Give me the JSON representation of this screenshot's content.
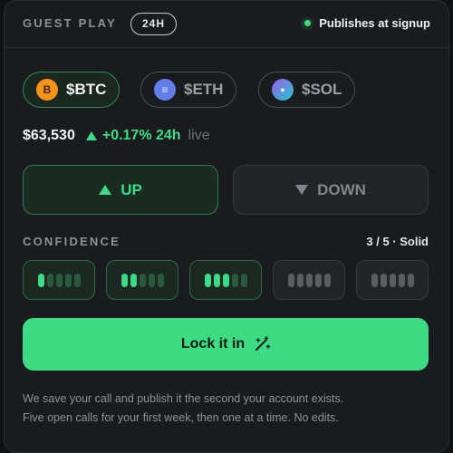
{
  "header": {
    "title": "GUEST PLAY",
    "period_pill": "24H",
    "publish_status": "Publishes at signup"
  },
  "coins": [
    {
      "label": "$BTC",
      "icon": "bitcoin-icon",
      "icon_glyph": "B",
      "color": "#f7931a",
      "active": true
    },
    {
      "label": "$ETH",
      "icon": "ethereum-icon",
      "icon_glyph": "≡",
      "color": "#627eea",
      "active": false
    },
    {
      "label": "$SOL",
      "icon": "solana-icon",
      "icon_glyph": "●",
      "color": "#7b6cf0",
      "active": false
    }
  ],
  "price": {
    "value": "$63,530",
    "change": "+0.17% 24h",
    "status": "live"
  },
  "direction": {
    "up_label": "UP",
    "down_label": "DOWN",
    "selected": "UP"
  },
  "confidence": {
    "label": "CONFIDENCE",
    "value_text": "3 / 5 · Solid",
    "level": 3,
    "max": 5
  },
  "lock_button": {
    "label": "Lock it in",
    "icon": "magic-wand-icon"
  },
  "footer": {
    "line1": "We save your call and publish it the second your account exists.",
    "line2": "Five open calls for your first week, then one at a time. No edits."
  },
  "colors": {
    "accent": "#3ddc84",
    "background": "#191b1e",
    "muted_text": "#8d9298"
  }
}
